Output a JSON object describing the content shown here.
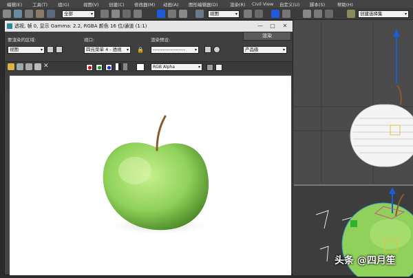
{
  "menu": [
    "编辑(E)",
    "工具(T)",
    "组(G)",
    "视图(V)",
    "创建(C)",
    "修改器(M)",
    "动画(A)",
    "图形编辑器(D)",
    "渲染(R)",
    "Civil View",
    "自定义(U)",
    "脚本(S)",
    "帮助(H)"
  ],
  "toolbar": {
    "selection_filter": "全部",
    "ref_coord": "视图",
    "named_set": "创建选择集"
  },
  "render_window": {
    "title": "透视, 帧 0, 显示 Gamma: 2.2, RGBA 颜色 16 位/通道 (1:1)",
    "area_label": "要渲染的区域:",
    "area_value": "视图",
    "viewport_label": "视口:",
    "viewport_value": "四元菜单 4 - 透视",
    "preset_label": "渲染预设:",
    "preset_value": "--------------------",
    "render_button": "渲染",
    "product_value": "产品级",
    "channel_value": "RGB Alpha"
  },
  "colors": {
    "apple_light": "#c9f08e",
    "apple_mid": "#8fd15a",
    "apple_dark": "#3e7a1c",
    "stem": "#8a5a2a",
    "selection_blue": "#1e5bd8"
  },
  "watermark": "头条 @四月笙"
}
